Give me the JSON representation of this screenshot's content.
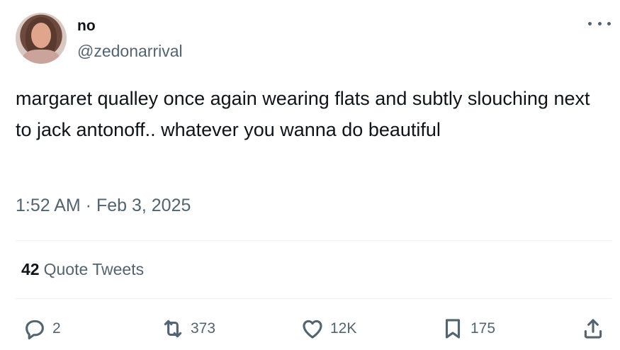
{
  "author": {
    "display_name": "no",
    "handle": "@zedonarrival"
  },
  "tweet": {
    "text": "margaret qualley once again wearing flats and subtly slouching next to jack antonoff.. whatever you wanna do beautiful",
    "timestamp": "1:52 AM · Feb 3, 2025"
  },
  "quotes": {
    "count": "42",
    "label": "Quote Tweets"
  },
  "actions": {
    "replies": "2",
    "retweets": "373",
    "likes": "12K",
    "bookmarks": "175"
  },
  "colors": {
    "text_primary": "#0f1419",
    "text_secondary": "#536471",
    "divider": "#eff3f4"
  }
}
